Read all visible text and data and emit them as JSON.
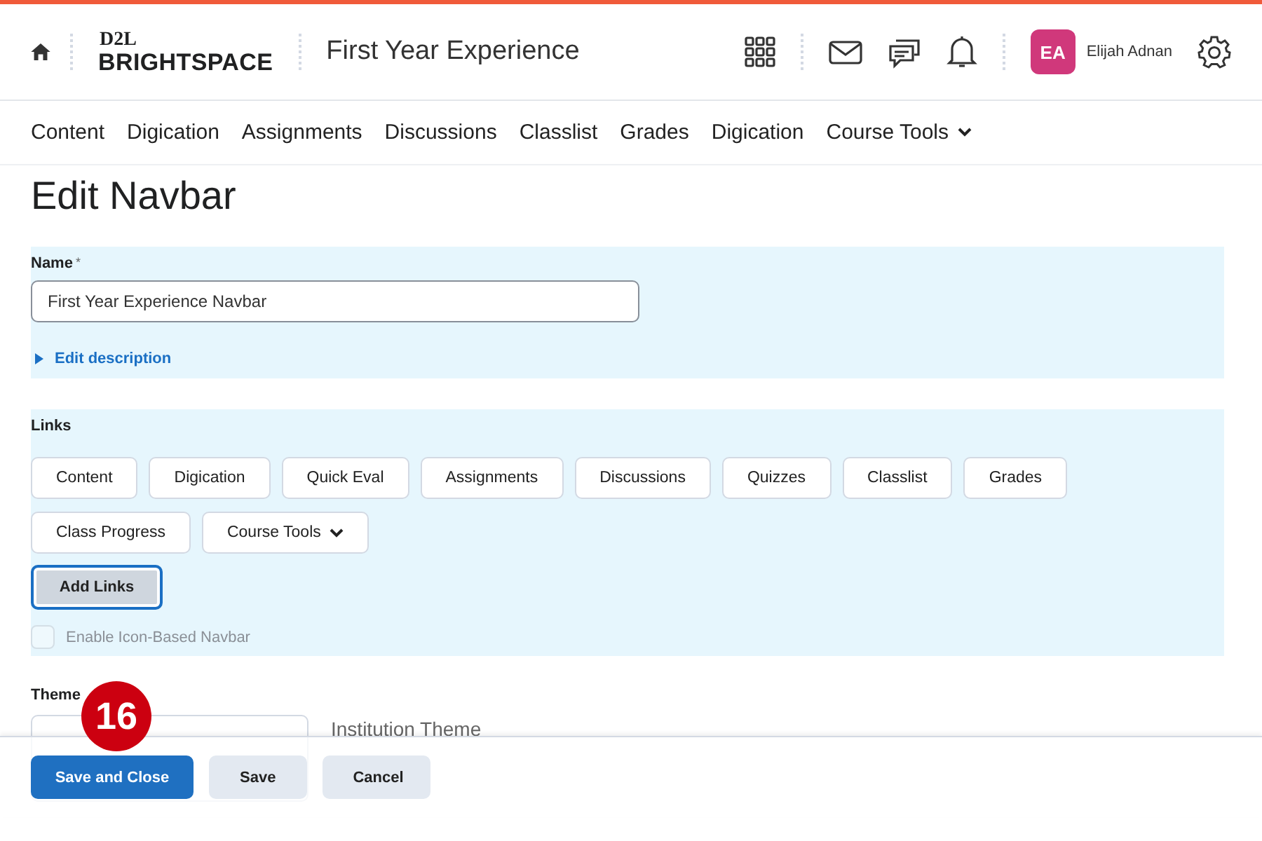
{
  "header": {
    "logo_top": "D2L",
    "logo_bottom": "BRIGHTSPACE",
    "course_title": "First Year Experience",
    "user": {
      "initials": "EA",
      "name": "Elijah Adnan"
    }
  },
  "nav": [
    {
      "label": "Content",
      "kind": "link"
    },
    {
      "label": "Digication",
      "kind": "link"
    },
    {
      "label": "Assignments",
      "kind": "link"
    },
    {
      "label": "Discussions",
      "kind": "link"
    },
    {
      "label": "Classlist",
      "kind": "link"
    },
    {
      "label": "Grades",
      "kind": "link"
    },
    {
      "label": "Digication",
      "kind": "link"
    },
    {
      "label": "Course Tools",
      "kind": "menu"
    }
  ],
  "page_title": "Edit Navbar",
  "name_section": {
    "label": "Name",
    "required_mark": "*",
    "value": "First Year Experience Navbar",
    "description_toggle": {
      "label": "Edit description",
      "expanded": false
    }
  },
  "links_section": {
    "label": "Links",
    "links": [
      {
        "label": "Content",
        "kind": "link"
      },
      {
        "label": "Digication",
        "kind": "link"
      },
      {
        "label": "Quick Eval",
        "kind": "link"
      },
      {
        "label": "Assignments",
        "kind": "link"
      },
      {
        "label": "Discussions",
        "kind": "link"
      },
      {
        "label": "Quizzes",
        "kind": "link"
      },
      {
        "label": "Classlist",
        "kind": "link"
      },
      {
        "label": "Grades",
        "kind": "link"
      },
      {
        "label": "Class Progress",
        "kind": "link"
      },
      {
        "label": "Course Tools",
        "kind": "menu"
      }
    ],
    "add_button": "Add Links",
    "icon_navbar": {
      "label": "Enable Icon-Based Navbar",
      "checked": false,
      "disabled": true
    }
  },
  "theme_section": {
    "label": "Theme",
    "theme_name": "Institution Theme"
  },
  "step_badge": "16",
  "footer": {
    "buttons": [
      {
        "label": "Save and Close",
        "kind": "primary"
      },
      {
        "label": "Save",
        "kind": "secondary"
      },
      {
        "label": "Cancel",
        "kind": "secondary"
      }
    ]
  }
}
